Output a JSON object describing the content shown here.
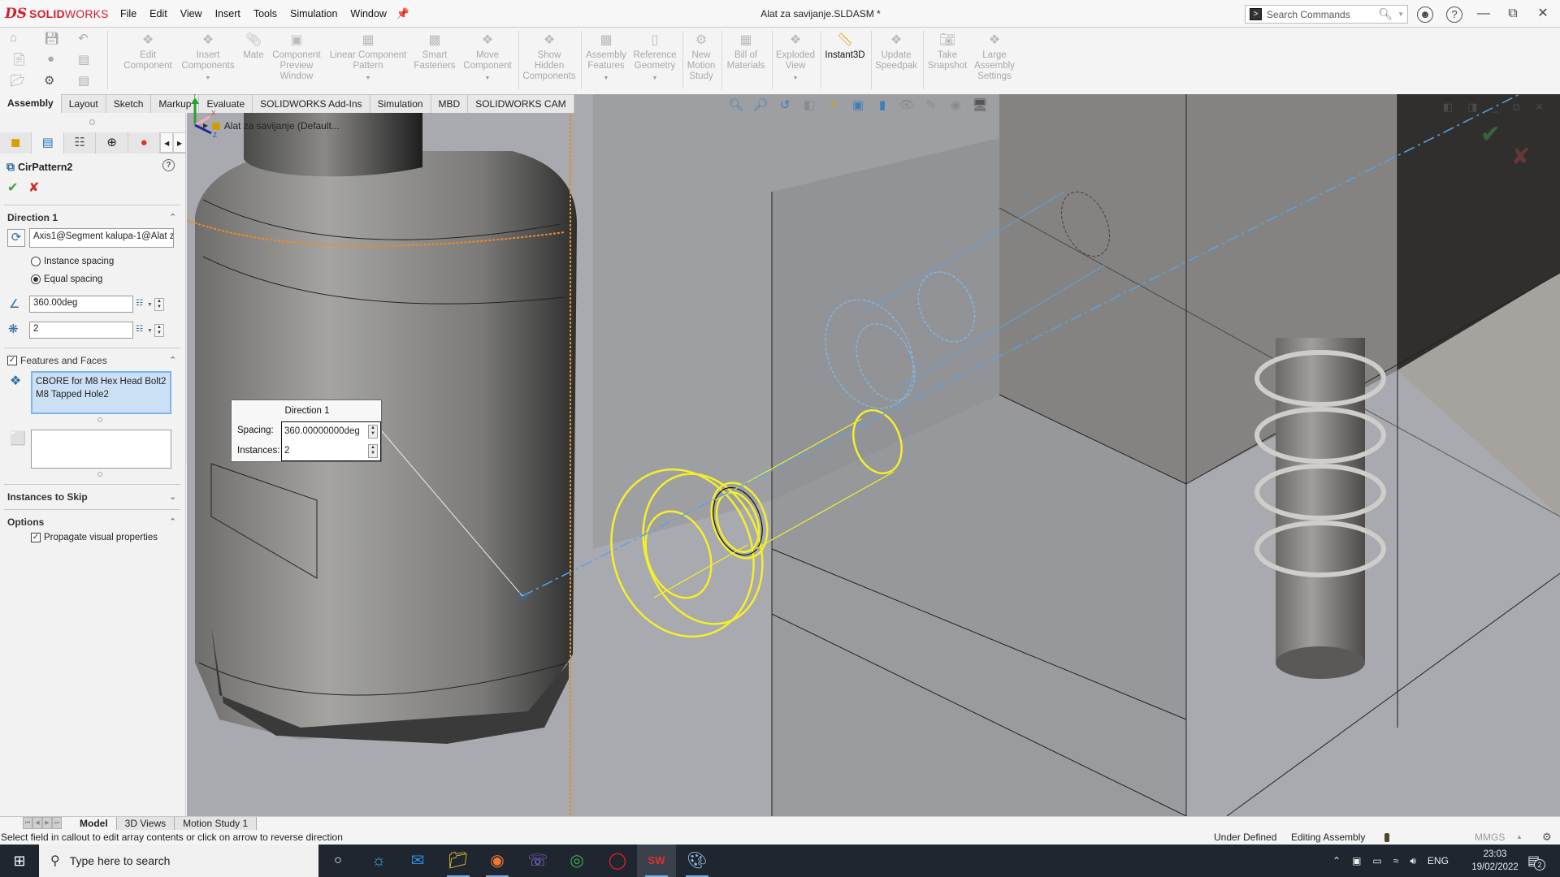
{
  "app": {
    "brand_prefix": "DS",
    "brand_bold": "SOLID",
    "brand_rest": "WORKS",
    "document_title": "Alat za savijanje.SLDASM *"
  },
  "menu": [
    "File",
    "Edit",
    "View",
    "Insert",
    "Tools",
    "Simulation",
    "Window"
  ],
  "search_commands": {
    "placeholder": "Search Commands"
  },
  "toolbar": {
    "commands": [
      {
        "label": "Edit\nComponent",
        "icon": "edit-component-icon",
        "enabled": false,
        "dropdown": false
      },
      {
        "label": "Insert\nComponents",
        "icon": "insert-components-icon",
        "enabled": false,
        "dropdown": true
      },
      {
        "label": "Mate",
        "icon": "mate-icon",
        "enabled": false,
        "dropdown": false
      },
      {
        "label": "Component\nPreview\nWindow",
        "icon": "component-preview-icon",
        "enabled": false,
        "dropdown": false
      },
      {
        "label": "Linear Component\nPattern",
        "icon": "linear-pattern-icon",
        "enabled": false,
        "dropdown": true
      },
      {
        "label": "Smart\nFasteners",
        "icon": "smart-fasteners-icon",
        "enabled": false,
        "dropdown": false
      },
      {
        "label": "Move\nComponent",
        "icon": "move-component-icon",
        "enabled": false,
        "dropdown": true
      },
      {
        "label": "Show\nHidden\nComponents",
        "icon": "show-hidden-icon",
        "enabled": false,
        "dropdown": false
      },
      {
        "label": "Assembly\nFeatures",
        "icon": "assembly-features-icon",
        "enabled": false,
        "dropdown": true
      },
      {
        "label": "Reference\nGeometry",
        "icon": "reference-geometry-icon",
        "enabled": false,
        "dropdown": true
      },
      {
        "label": "New\nMotion\nStudy",
        "icon": "motion-study-icon",
        "enabled": false,
        "dropdown": false
      },
      {
        "label": "Bill of\nMaterials",
        "icon": "bom-icon",
        "enabled": false,
        "dropdown": false
      },
      {
        "label": "Exploded\nView",
        "icon": "exploded-view-icon",
        "enabled": false,
        "dropdown": true
      },
      {
        "label": "Instant3D",
        "icon": "instant3d-icon",
        "enabled": true,
        "dropdown": false
      },
      {
        "label": "Update\nSpeedpak",
        "icon": "speedpak-icon",
        "enabled": false,
        "dropdown": false
      },
      {
        "label": "Take\nSnapshot",
        "icon": "snapshot-icon",
        "enabled": false,
        "dropdown": false
      },
      {
        "label": "Large\nAssembly\nSettings",
        "icon": "large-assembly-icon",
        "enabled": false,
        "dropdown": false
      }
    ]
  },
  "cm_tabs": [
    {
      "label": "Assembly",
      "active": true
    },
    {
      "label": "Layout",
      "active": false
    },
    {
      "label": "Sketch",
      "active": false
    },
    {
      "label": "Markup",
      "active": false
    },
    {
      "label": "Evaluate",
      "active": false
    },
    {
      "label": "SOLIDWORKS Add-Ins",
      "active": false
    },
    {
      "label": "Simulation",
      "active": false
    },
    {
      "label": "MBD",
      "active": false
    },
    {
      "label": "SOLIDWORKS CAM",
      "active": false
    }
  ],
  "property_manager": {
    "title": "CirPattern2",
    "direction1": {
      "heading": "Direction 1",
      "axis": "Axis1@Segment kalupa-1@Alat z",
      "instance_spacing_label": "Instance spacing",
      "equal_spacing_label": "Equal spacing",
      "selected_spacing": "equal",
      "angle": "360.00deg",
      "instances": "2"
    },
    "features_faces": {
      "heading": "Features and Faces",
      "checked": true,
      "features": [
        "CBORE for M8 Hex Head Bolt2",
        "M8 Tapped Hole2"
      ],
      "faces": []
    },
    "instances_to_skip": {
      "heading": "Instances to Skip",
      "expanded": false
    },
    "options": {
      "heading": "Options",
      "propagate_label": "Propagate visual properties",
      "propagate_checked": true
    }
  },
  "viewport": {
    "tree_flyout": "Alat za savijanje  (Default...",
    "callout": {
      "title": "Direction 1",
      "spacing_label": "Spacing:",
      "spacing_value": "360.00000000deg",
      "instances_label": "Instances:",
      "instances_value": "2"
    },
    "triad": {
      "x": "X",
      "y": "Y",
      "z": "Z"
    },
    "colors": {
      "selection": "#f5ef2a",
      "axis": "#5aa2e8",
      "edge_highlight": "#f08a24"
    }
  },
  "bottom_tabs": [
    {
      "label": "Model",
      "active": true
    },
    {
      "label": "3D Views",
      "active": false
    },
    {
      "label": "Motion Study 1",
      "active": false
    }
  ],
  "status": {
    "message": "Select field in callout to edit array contents or click on arrow to reverse direction",
    "definition": "Under Defined",
    "mode": "Editing Assembly",
    "units": "MMGS"
  },
  "taskbar": {
    "search_placeholder": "Type here to search",
    "apps": [
      "cortana",
      "edge",
      "mail",
      "file-explorer",
      "firefox",
      "viber",
      "chrome",
      "opera",
      "solidworks-2020",
      "paint"
    ],
    "language": "ENG",
    "time": "23:03",
    "date": "19/02/2022",
    "notifications": "2"
  }
}
